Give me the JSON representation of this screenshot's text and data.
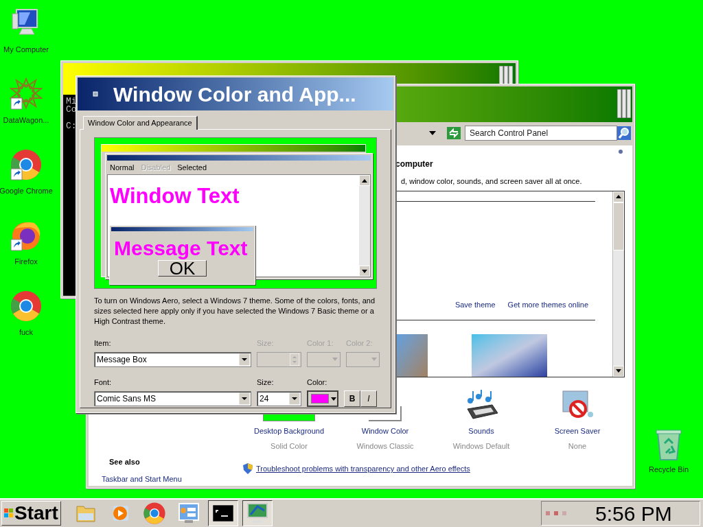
{
  "desktop": {
    "icons": [
      {
        "label": "My Computer",
        "kind": "computer",
        "shortcut": false
      },
      {
        "label": "DataWagon...",
        "kind": "star",
        "shortcut": true
      },
      {
        "label": "Google Chrome",
        "kind": "chrome",
        "shortcut": true
      },
      {
        "label": "Firefox",
        "kind": "firefox",
        "shortcut": true
      },
      {
        "label": "fuck",
        "kind": "chrome",
        "shortcut": false
      }
    ],
    "recycle_bin": {
      "label": "Recycle Bin"
    }
  },
  "console_window": {
    "lines": [
      "Mi",
      "Co",
      "C:"
    ]
  },
  "control_panel": {
    "search": {
      "placeholder": "Search Control Panel"
    },
    "heading": "computer",
    "description": "d, window color, sounds, and screen saver all at once.",
    "theme_links": [
      "Save theme",
      "Get more themes online"
    ],
    "settings": [
      {
        "label": "Desktop Background",
        "value": "Solid Color",
        "kind": "background"
      },
      {
        "label": "Window Color",
        "value": "Windows Classic",
        "kind": "window"
      },
      {
        "label": "Sounds",
        "value": "Windows Default",
        "kind": "sounds"
      },
      {
        "label": "Screen Saver",
        "value": "None",
        "kind": "screensaver"
      }
    ],
    "see_also": {
      "title": "See also",
      "links": [
        "Taskbar and Start Menu"
      ]
    },
    "troubleshoot_link": "Troubleshoot problems with transparency and other Aero effects"
  },
  "dialog": {
    "title": "Window Color and App...",
    "tabs": [
      {
        "label": "Window Color and Appearance",
        "selected": true
      }
    ],
    "preview": {
      "menu": [
        {
          "label": "Normal",
          "disabled": false
        },
        {
          "label": "Disabled",
          "disabled": true
        },
        {
          "label": "Selected",
          "disabled": false
        }
      ],
      "window_text": "Window Text",
      "message_text": "Message Text",
      "ok_label": "OK"
    },
    "info": "To turn on Windows Aero, select a Windows 7 theme.  Some of the colors, fonts, and sizes selected here apply only if you have selected the Windows 7 Basic theme or a High Contrast theme.",
    "item": {
      "label": "Item:",
      "value": "Message Box"
    },
    "item_size": {
      "label": "Size:",
      "disabled": true
    },
    "color_1": {
      "label": "Color 1:",
      "disabled": true
    },
    "color_2": {
      "label": "Color 2:",
      "disabled": true
    },
    "font": {
      "label": "Font:",
      "value": "Comic Sans MS"
    },
    "font_size": {
      "label": "Size:",
      "value": "24"
    },
    "font_color": {
      "label": "Color:",
      "color": "#ff00ff"
    },
    "style_buttons": [
      {
        "label": "B",
        "kind": "bold"
      },
      {
        "label": "I",
        "kind": "italic"
      }
    ]
  },
  "taskbar": {
    "start_label": "Start",
    "items": [
      {
        "kind": "explorer",
        "active": false
      },
      {
        "kind": "media",
        "active": false
      },
      {
        "kind": "chrome",
        "active": false
      },
      {
        "kind": "control-panel",
        "active": false
      },
      {
        "kind": "console",
        "active": true
      },
      {
        "kind": "display",
        "active": true
      }
    ],
    "clock": "5:56 PM"
  }
}
